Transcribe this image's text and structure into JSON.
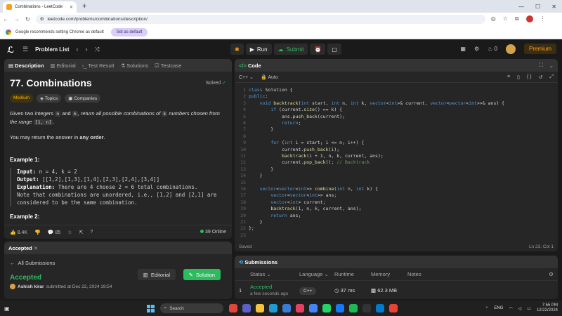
{
  "browser": {
    "tab_title": "Combinations - LeetCode",
    "url": "leetcode.com/problems/combinations/description/",
    "info_text": "Google recommends setting Chrome as default",
    "set_default_label": "Set as default"
  },
  "nav": {
    "problem_list": "Problem List",
    "run": "Run",
    "submit": "Submit",
    "streak": "0",
    "premium": "Premium"
  },
  "description": {
    "tabs": [
      "Description",
      "Editorial",
      "Test Result",
      "Solutions",
      "Testcase"
    ],
    "title": "77. Combinations",
    "solved": "Solved",
    "tags": [
      "Medium",
      "Topics",
      "Companies"
    ],
    "text1a": "Given two integers ",
    "n": "n",
    "and": " and ",
    "k": "k",
    "text1b": ", return all possible combinations of ",
    "text1c": " numbers chosen from the range ",
    "range": "[1, n]",
    "period": ".",
    "text2a": "You may return the answer in ",
    "text2b": "any order",
    "example_title": "Example 1:",
    "input_label": "Input:",
    "input_value": " n = 4, k = 2",
    "output_label": "Output:",
    "output_value": " [[1,2],[1,3],[1,4],[2,3],[2,4],[3,4]]",
    "expl_label": "Explanation:",
    "expl_value": " There are 4 choose 2 = 6 total combinations.",
    "expl_2": "Note that combinations are unordered, i.e., [1,2] and [2,1] are",
    "expl_3": "considered to be the same combination.",
    "example2_title": "Example 2:",
    "likes": "8.4K",
    "comments": "85",
    "online": "39 Online"
  },
  "code": {
    "title": "Code",
    "language": "C++",
    "mode": "Auto",
    "saved": "Saved",
    "cursor": "Ln 23, Col 1",
    "lines": [
      "class Solution {",
      "public:",
      "    void backtrack(int start, int n, int k, vector<int>& current, vector<vector<int>>& ans) {",
      "        if (current.size() == k) {",
      "            ans.push_back(current);",
      "            return;",
      "        }",
      "",
      "        for (int i = start; i <= n; i++) {",
      "            current.push_back(i);",
      "            backtrack(i + 1, n, k, current, ans);",
      "            current.pop_back(); ",
      "        }",
      "    }",
      "",
      "    vector<vector<int>> combine(int n, int k) {",
      "        vector<vector<int>> ans;",
      "        vector<int> current;",
      "        backtrack(1, n, k, current, ans);",
      "        return ans;",
      "    }",
      "};",
      ""
    ],
    "comment_12": "// Backtrack"
  },
  "accepted": {
    "tab": "Accepted",
    "all_submissions": "All Submissions",
    "status": "Accepted",
    "user": "Ashish kirar",
    "submitted": " submitted at Dec 22, 2024 19:54",
    "editorial_btn": "Editorial",
    "solution_btn": "Solution"
  },
  "submissions": {
    "title": "Submissions",
    "headers": [
      "Status",
      "Language",
      "Runtime",
      "Memory",
      "Notes"
    ],
    "row": {
      "index": "1",
      "status": "Accepted",
      "when": "a few seconds ago",
      "language": "C++",
      "runtime": "37 ms",
      "memory": "62.3 MB"
    }
  },
  "taskbar": {
    "search": "Search",
    "lang": "ENG",
    "time": "7:55 PM",
    "date": "12/22/2024"
  },
  "colors": {
    "accent_green": "#2cbb5d",
    "medium": "#ffb800",
    "premium": "#ffa116"
  }
}
